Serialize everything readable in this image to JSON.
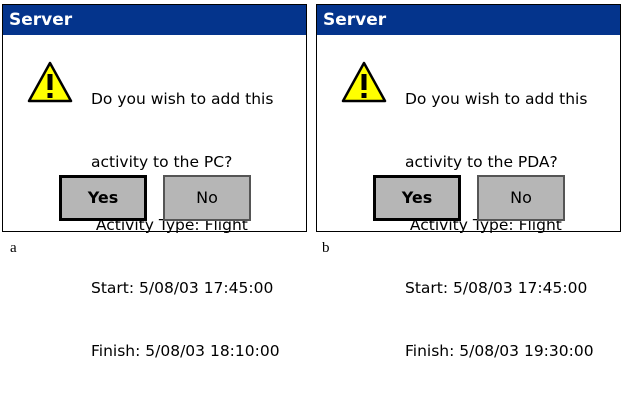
{
  "dialogs": [
    {
      "title": "Server",
      "icon": "warning-icon",
      "lines": [
        "Do you wish to add this",
        "activity to the PC?",
        " Activity Type: Flight",
        "Start: 5/08/03 17:45:00",
        "Finish: 5/08/03 18:10:00"
      ],
      "buttons": {
        "yes": "Yes",
        "no": "No"
      },
      "caption": "a"
    },
    {
      "title": "Server",
      "icon": "warning-icon",
      "lines": [
        "Do you wish to add this",
        "activity to the PDA?",
        " Activity Type: Flight",
        "Start: 5/08/03 17:45:00",
        "Finish: 5/08/03 19:30:00"
      ],
      "buttons": {
        "yes": "Yes",
        "no": "No"
      },
      "caption": "b"
    }
  ],
  "colors": {
    "titlebar": "#04348c",
    "button_face": "#b6b6b6",
    "warning_fill": "#ffff00"
  }
}
